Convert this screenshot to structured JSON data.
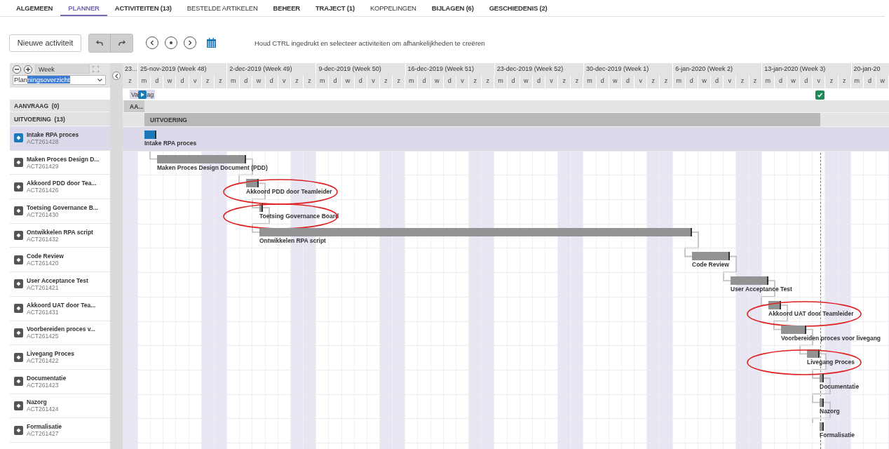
{
  "tabs": [
    {
      "label": "ALGEMEEN",
      "selected": false,
      "emphasized": true
    },
    {
      "label": "PLANNER",
      "selected": true,
      "emphasized": true
    },
    {
      "label": "ACTIVITEITEN (13)",
      "selected": false,
      "emphasized": true
    },
    {
      "label": "BESTELDE ARTIKELEN",
      "selected": false,
      "emphasized": false
    },
    {
      "label": "BEHEER",
      "selected": false,
      "emphasized": true
    },
    {
      "label": "TRAJECT (1)",
      "selected": false,
      "emphasized": true
    },
    {
      "label": "KOPPELINGEN",
      "selected": false,
      "emphasized": false
    },
    {
      "label": "BIJLAGEN (6)",
      "selected": false,
      "emphasized": true
    },
    {
      "label": "GESCHIEDENIS (2)",
      "selected": false,
      "emphasized": true
    }
  ],
  "toolbar": {
    "new_button": "Nieuwe activiteit",
    "hint": "Houd CTRL ingedrukt en selecteer activiteiten om afhankelijkheden te creëren"
  },
  "controls": {
    "scale": "Week",
    "view": "Planningsoverzicht"
  },
  "timeline": {
    "weeks": [
      {
        "label": "23...",
        "days": [
          {
            "label": "z",
            "weekend": true
          }
        ]
      },
      {
        "label": "25-nov-2019 (Week 48)",
        "days": [
          {
            "label": "m",
            "weekend": false
          },
          {
            "label": "d",
            "weekend": false
          },
          {
            "label": "w",
            "weekend": false
          },
          {
            "label": "d",
            "weekend": false
          },
          {
            "label": "v",
            "weekend": false
          },
          {
            "label": "z",
            "weekend": true
          },
          {
            "label": "z",
            "weekend": true
          }
        ]
      },
      {
        "label": "2-dec-2019 (Week 49)",
        "days": [
          {
            "label": "m",
            "weekend": false
          },
          {
            "label": "d",
            "weekend": false
          },
          {
            "label": "w",
            "weekend": false
          },
          {
            "label": "d",
            "weekend": false
          },
          {
            "label": "v",
            "weekend": false
          },
          {
            "label": "z",
            "weekend": true
          },
          {
            "label": "z",
            "weekend": true
          }
        ]
      },
      {
        "label": "9-dec-2019 (Week 50)",
        "days": [
          {
            "label": "m",
            "weekend": false
          },
          {
            "label": "d",
            "weekend": false
          },
          {
            "label": "w",
            "weekend": false
          },
          {
            "label": "d",
            "weekend": false
          },
          {
            "label": "v",
            "weekend": false
          },
          {
            "label": "z",
            "weekend": true
          },
          {
            "label": "z",
            "weekend": true
          }
        ]
      },
      {
        "label": "16-dec-2019 (Week 51)",
        "days": [
          {
            "label": "m",
            "weekend": false
          },
          {
            "label": "d",
            "weekend": false
          },
          {
            "label": "w",
            "weekend": false
          },
          {
            "label": "d",
            "weekend": false
          },
          {
            "label": "v",
            "weekend": false
          },
          {
            "label": "z",
            "weekend": true
          },
          {
            "label": "z",
            "weekend": true
          }
        ]
      },
      {
        "label": "23-dec-2019 (Week 52)",
        "days": [
          {
            "label": "m",
            "weekend": false
          },
          {
            "label": "d",
            "weekend": false
          },
          {
            "label": "w",
            "weekend": false
          },
          {
            "label": "d",
            "weekend": false
          },
          {
            "label": "v",
            "weekend": false
          },
          {
            "label": "z",
            "weekend": true
          },
          {
            "label": "z",
            "weekend": true
          }
        ]
      },
      {
        "label": "30-dec-2019 (Week 1)",
        "days": [
          {
            "label": "m",
            "weekend": false
          },
          {
            "label": "d",
            "weekend": false
          },
          {
            "label": "w",
            "weekend": false
          },
          {
            "label": "d",
            "weekend": false
          },
          {
            "label": "v",
            "weekend": false
          },
          {
            "label": "z",
            "weekend": true
          },
          {
            "label": "z",
            "weekend": true
          }
        ]
      },
      {
        "label": "6-jan-2020 (Week 2)",
        "days": [
          {
            "label": "m",
            "weekend": false
          },
          {
            "label": "d",
            "weekend": false
          },
          {
            "label": "w",
            "weekend": false
          },
          {
            "label": "d",
            "weekend": false
          },
          {
            "label": "v",
            "weekend": false
          },
          {
            "label": "z",
            "weekend": true
          },
          {
            "label": "z",
            "weekend": true
          }
        ]
      },
      {
        "label": "13-jan-2020 (Week 3)",
        "days": [
          {
            "label": "m",
            "weekend": false
          },
          {
            "label": "d",
            "weekend": false
          },
          {
            "label": "w",
            "weekend": false
          },
          {
            "label": "d",
            "weekend": false
          },
          {
            "label": "v",
            "weekend": false
          },
          {
            "label": "z",
            "weekend": true
          },
          {
            "label": "z",
            "weekend": true
          }
        ]
      },
      {
        "label": "20-jan-20",
        "days": [
          {
            "label": "m",
            "weekend": false
          },
          {
            "label": "d",
            "weekend": false
          },
          {
            "label": "w",
            "weekend": false
          }
        ]
      }
    ],
    "today_label_left": "Va",
    "today_label_right": "ag"
  },
  "groups": [
    {
      "label": "AANVRAAG  (0)",
      "bar_label": "AA..."
    },
    {
      "label": "UITVOERING  (13)",
      "bar_label": "UITVOERING"
    }
  ],
  "activities": [
    {
      "name": "Intake RPA proces",
      "id": "ACT261428",
      "bar_label": "Intake RPA proces",
      "selected": true,
      "circled": false
    },
    {
      "name": "Maken Proces Design D...",
      "id": "ACT261429",
      "bar_label": "Maken Proces Design Document (PDD)",
      "selected": false,
      "circled": false
    },
    {
      "name": "Akkoord PDD door Tea...",
      "id": "ACT261426",
      "bar_label": "Akkoord PDD door Teamleider",
      "selected": false,
      "circled": true
    },
    {
      "name": "Toetsing Governance B...",
      "id": "ACT261430",
      "bar_label": "Toetsing Governance Board",
      "selected": false,
      "circled": true
    },
    {
      "name": "Ontwikkelen RPA script",
      "id": "ACT261432",
      "bar_label": "Ontwikkelen RPA script",
      "selected": false,
      "circled": false
    },
    {
      "name": "Code Review",
      "id": "ACT261420",
      "bar_label": "Code Review",
      "selected": false,
      "circled": false
    },
    {
      "name": "User Acceptance Test",
      "id": "ACT261421",
      "bar_label": "User Acceptance Test",
      "selected": false,
      "circled": false
    },
    {
      "name": "Akkoord UAT door Tea...",
      "id": "ACT261431",
      "bar_label": "Akkoord UAT door Teamleider",
      "selected": false,
      "circled": true
    },
    {
      "name": "Voorbereiden proces v...",
      "id": "ACT261425",
      "bar_label": "Voorbereiden proces voor livegang",
      "selected": false,
      "circled": false
    },
    {
      "name": "Livegang Proces",
      "id": "ACT261422",
      "bar_label": "Livegang Proces",
      "selected": false,
      "circled": true
    },
    {
      "name": "Documentatie",
      "id": "ACT261423",
      "bar_label": "Documentatie",
      "selected": false,
      "circled": false
    },
    {
      "name": "Nazorg",
      "id": "ACT261424",
      "bar_label": "Nazorg",
      "selected": false,
      "circled": false
    },
    {
      "name": "Formalisatie",
      "id": "ACT261427",
      "bar_label": "Formalisatie",
      "selected": false,
      "circled": false
    }
  ]
}
